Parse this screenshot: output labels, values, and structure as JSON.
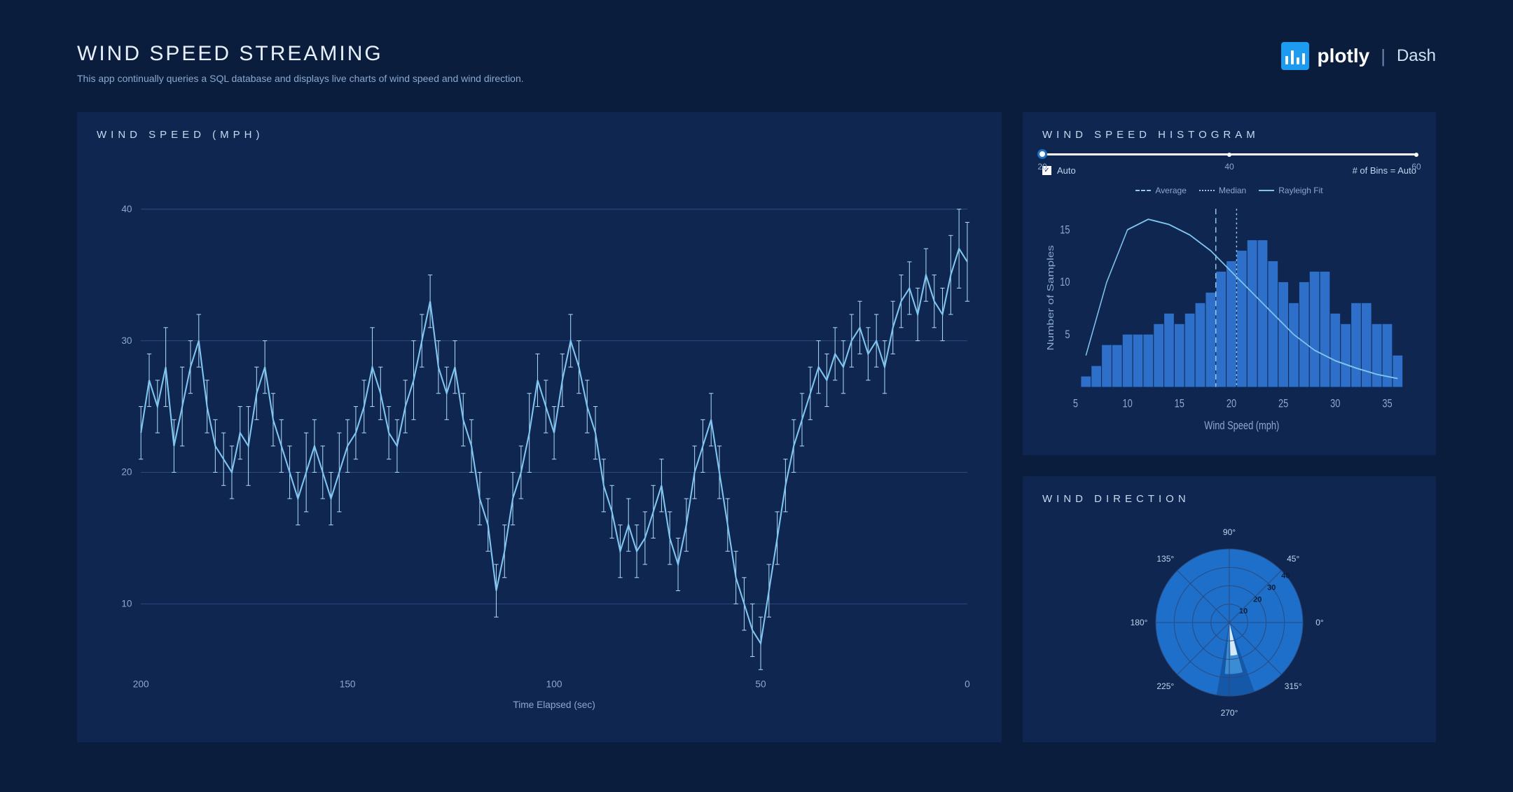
{
  "header": {
    "title": "WIND SPEED STREAMING",
    "subtitle": "This app continually queries a SQL database and displays live charts of wind speed and wind direction.",
    "brand_name": "plotly",
    "brand_product": "Dash"
  },
  "panels": {
    "main": {
      "title": "WIND SPEED (MPH)"
    },
    "histogram": {
      "title": "WIND SPEED HISTOGRAM",
      "slider": {
        "min": 20,
        "mid": 40,
        "max": 60,
        "value": 20
      },
      "auto_label": "Auto",
      "bins_label": "# of Bins = Auto",
      "legend": {
        "average": "Average",
        "median": "Median",
        "rayleigh": "Rayleigh Fit"
      }
    },
    "direction": {
      "title": "WIND DIRECTION"
    }
  },
  "chart_data": [
    {
      "id": "wind_speed_timeseries",
      "type": "line",
      "title": "WIND SPEED (MPH)",
      "xlabel": "Time Elapsed (sec)",
      "ylabel": "",
      "xlim": [
        200,
        0
      ],
      "ylim": [
        5,
        42
      ],
      "x_ticks": [
        200,
        150,
        100,
        50,
        0
      ],
      "y_ticks": [
        10,
        20,
        30,
        40
      ],
      "x": [
        200,
        198,
        196,
        194,
        192,
        190,
        188,
        186,
        184,
        182,
        180,
        178,
        176,
        174,
        172,
        170,
        168,
        166,
        164,
        162,
        160,
        158,
        156,
        154,
        152,
        150,
        148,
        146,
        144,
        142,
        140,
        138,
        136,
        134,
        132,
        130,
        128,
        126,
        124,
        122,
        120,
        118,
        116,
        114,
        112,
        110,
        108,
        106,
        104,
        102,
        100,
        98,
        96,
        94,
        92,
        90,
        88,
        86,
        84,
        82,
        80,
        78,
        76,
        74,
        72,
        70,
        68,
        66,
        64,
        62,
        60,
        58,
        56,
        54,
        52,
        50,
        48,
        46,
        44,
        42,
        40,
        38,
        36,
        34,
        32,
        30,
        28,
        26,
        24,
        22,
        20,
        18,
        16,
        14,
        12,
        10,
        8,
        6,
        4,
        2,
        0
      ],
      "values": [
        23,
        27,
        25,
        28,
        22,
        25,
        28,
        30,
        25,
        22,
        21,
        20,
        23,
        22,
        26,
        28,
        24,
        22,
        20,
        18,
        20,
        22,
        20,
        18,
        20,
        22,
        23,
        25,
        28,
        26,
        23,
        22,
        25,
        27,
        30,
        33,
        28,
        26,
        28,
        24,
        22,
        18,
        16,
        11,
        14,
        18,
        20,
        23,
        27,
        25,
        23,
        27,
        30,
        28,
        25,
        23,
        19,
        17,
        14,
        16,
        14,
        15,
        17,
        19,
        15,
        13,
        16,
        20,
        22,
        24,
        20,
        16,
        12,
        10,
        8,
        7,
        11,
        15,
        19,
        22,
        24,
        26,
        28,
        27,
        29,
        28,
        30,
        31,
        29,
        30,
        28,
        31,
        33,
        34,
        32,
        35,
        33,
        32,
        35,
        37,
        36
      ],
      "error": [
        2,
        2,
        2,
        3,
        2,
        3,
        2,
        2,
        2,
        2,
        2,
        2,
        2,
        3,
        2,
        2,
        2,
        2,
        2,
        2,
        3,
        2,
        2,
        2,
        3,
        2,
        2,
        2,
        3,
        2,
        2,
        2,
        2,
        3,
        2,
        2,
        2,
        2,
        2,
        2,
        2,
        2,
        2,
        2,
        2,
        2,
        2,
        3,
        2,
        2,
        2,
        2,
        2,
        2,
        2,
        2,
        2,
        2,
        2,
        2,
        2,
        2,
        2,
        2,
        2,
        2,
        2,
        2,
        2,
        2,
        2,
        2,
        2,
        2,
        2,
        2,
        2,
        2,
        2,
        2,
        2,
        2,
        2,
        2,
        2,
        2,
        2,
        2,
        2,
        2,
        2,
        2,
        2,
        2,
        2,
        2,
        2,
        2,
        3,
        3,
        3
      ]
    },
    {
      "id": "wind_speed_histogram",
      "type": "bar",
      "title": "WIND SPEED HISTOGRAM",
      "xlabel": "Wind Speed (mph)",
      "ylabel": "Number of Samples",
      "xlim": [
        5,
        37
      ],
      "ylim": [
        0,
        17
      ],
      "x_ticks": [
        5,
        10,
        15,
        20,
        25,
        30,
        35
      ],
      "y_ticks": [
        5,
        10,
        15
      ],
      "categories": [
        6,
        7,
        8,
        9,
        10,
        11,
        12,
        13,
        14,
        15,
        16,
        17,
        18,
        19,
        20,
        21,
        22,
        23,
        24,
        25,
        26,
        27,
        28,
        29,
        30,
        31,
        32,
        33,
        34,
        35,
        36
      ],
      "values": [
        1,
        2,
        4,
        4,
        5,
        5,
        5,
        6,
        7,
        6,
        7,
        8,
        9,
        11,
        12,
        13,
        14,
        14,
        12,
        10,
        8,
        10,
        11,
        11,
        7,
        6,
        8,
        8,
        6,
        6,
        3
      ],
      "overlays": {
        "average_x": 18.5,
        "median_x": 20.5,
        "rayleigh_x": [
          6,
          8,
          10,
          12,
          14,
          16,
          18,
          20,
          22,
          24,
          26,
          28,
          30,
          32,
          34,
          36
        ],
        "rayleigh_y": [
          3,
          10,
          15,
          16,
          15.5,
          14.5,
          13,
          11,
          9,
          7,
          5,
          3.5,
          2.5,
          1.8,
          1.2,
          0.8
        ]
      }
    },
    {
      "id": "wind_direction_polar",
      "type": "polar",
      "title": "WIND DIRECTION",
      "angle_ticks": [
        0,
        45,
        90,
        135,
        180,
        225,
        270,
        315
      ],
      "radial_ticks": [
        10,
        20,
        30,
        40
      ],
      "wedges": [
        {
          "angle_deg": 275,
          "span_deg": 30,
          "radius": 40,
          "layer": "outer"
        },
        {
          "angle_deg": 275,
          "span_deg": 20,
          "radius": 28,
          "layer": "mid"
        },
        {
          "angle_deg": 278,
          "span_deg": 12,
          "radius": 18,
          "layer": "inner"
        }
      ]
    }
  ]
}
